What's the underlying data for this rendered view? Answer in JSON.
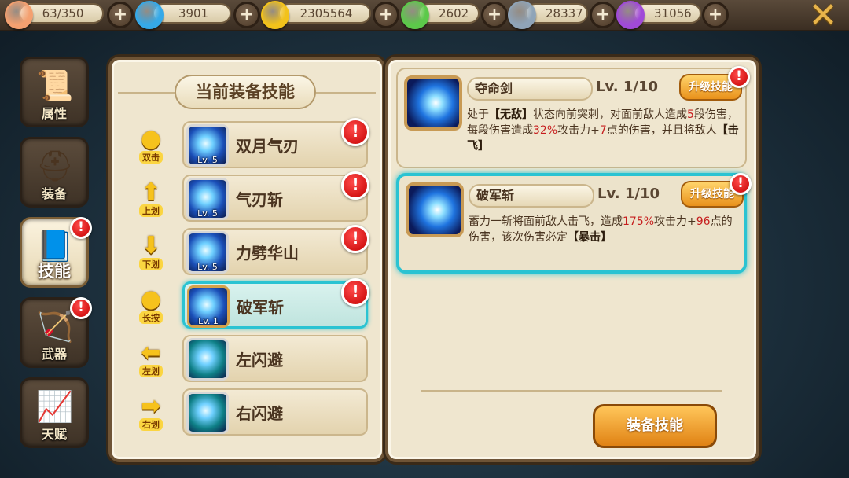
{
  "resources": [
    {
      "id": "stamina",
      "value": "63/350",
      "icon": "peach-icon",
      "color": "#f4a070"
    },
    {
      "id": "diamond",
      "value": "3901",
      "icon": "diamond-icon",
      "color": "#35a9e8"
    },
    {
      "id": "gold",
      "value": "2305564",
      "icon": "coin-icon",
      "color": "#f2c21b"
    },
    {
      "id": "lollipop",
      "value": "2602",
      "icon": "lollipop-icon",
      "color": "#5cc94a"
    },
    {
      "id": "honor",
      "value": "28337",
      "icon": "shield-badge-icon",
      "color": "#8fa4b8"
    },
    {
      "id": "star",
      "value": "31056",
      "icon": "purple-star-icon",
      "color": "#a04ad8"
    }
  ],
  "plus_label": "+",
  "close_label": "✕",
  "categories": [
    {
      "label": "属性",
      "icon": "scroll-icon",
      "art": "📜",
      "active": false,
      "alert": false
    },
    {
      "label": "装备",
      "icon": "helmet-icon",
      "art": "⛑",
      "active": false,
      "alert": false
    },
    {
      "label": "技能",
      "icon": "skill-book-icon",
      "art": "📘",
      "active": true,
      "alert": true
    },
    {
      "label": "武器",
      "icon": "bow-icon",
      "art": "🏹",
      "active": false,
      "alert": true
    },
    {
      "label": "天赋",
      "icon": "growth-chart-icon",
      "art": "📈",
      "active": false,
      "alert": false
    }
  ],
  "alert_symbol": "!",
  "equipped_title": "当前装备技能",
  "skills": [
    {
      "gesture": "双击",
      "gesture_icon": "double-tap-icon",
      "gesture_glyph": "●",
      "name": "双月气刃",
      "level": "Lv. 5",
      "alert": true,
      "selected": false
    },
    {
      "gesture": "上划",
      "gesture_icon": "swipe-up-icon",
      "gesture_glyph": "⬆",
      "name": "气刃斩",
      "level": "Lv. 5",
      "alert": true,
      "selected": false
    },
    {
      "gesture": "下划",
      "gesture_icon": "swipe-down-icon",
      "gesture_glyph": "⬇",
      "name": "力劈华山",
      "level": "Lv. 5",
      "alert": true,
      "selected": false
    },
    {
      "gesture": "长按",
      "gesture_icon": "long-press-icon",
      "gesture_glyph": "●",
      "name": "破军斩",
      "level": "Lv. 1",
      "alert": true,
      "selected": true
    },
    {
      "gesture": "左划",
      "gesture_icon": "swipe-left-icon",
      "gesture_glyph": "⬅",
      "name": "左闪避",
      "level": "",
      "alert": false,
      "selected": false
    },
    {
      "gesture": "右划",
      "gesture_icon": "swipe-right-icon",
      "gesture_glyph": "➡",
      "name": "右闪避",
      "level": "",
      "alert": false,
      "selected": false
    }
  ],
  "details": [
    {
      "name": "夺命剑",
      "level": "Lv.  1/10",
      "upgrade_label": "升级技能",
      "selected": false,
      "desc": [
        {
          "t": "处于"
        },
        {
          "t": "【无敌】",
          "kw": true
        },
        {
          "t": "状态向前突刺，对面前敌人造成"
        },
        {
          "t": "5",
          "hl": true
        },
        {
          "t": "段伤害，每段伤害造成"
        },
        {
          "t": "32%",
          "hl": true
        },
        {
          "t": "攻击力+"
        },
        {
          "t": "7",
          "hl": true
        },
        {
          "t": "点的伤害，并且将敌人"
        },
        {
          "t": "【击飞】",
          "kw": true
        }
      ]
    },
    {
      "name": "破军斩",
      "level": "Lv.  1/10",
      "upgrade_label": "升级技能",
      "selected": true,
      "desc": [
        {
          "t": "蓄力一斩将面前敌人击飞，造成"
        },
        {
          "t": "175%",
          "hl": true
        },
        {
          "t": "攻击力+"
        },
        {
          "t": "96",
          "hl": true
        },
        {
          "t": "点的伤害，该次伤害必定"
        },
        {
          "t": "【暴击】",
          "kw": true
        }
      ]
    }
  ],
  "equip_button_label": "装备技能",
  "colors": {
    "accent_cyan": "#2ac3d2",
    "highlight_red": "#c61d1d",
    "button_orange": "#e9911b"
  }
}
